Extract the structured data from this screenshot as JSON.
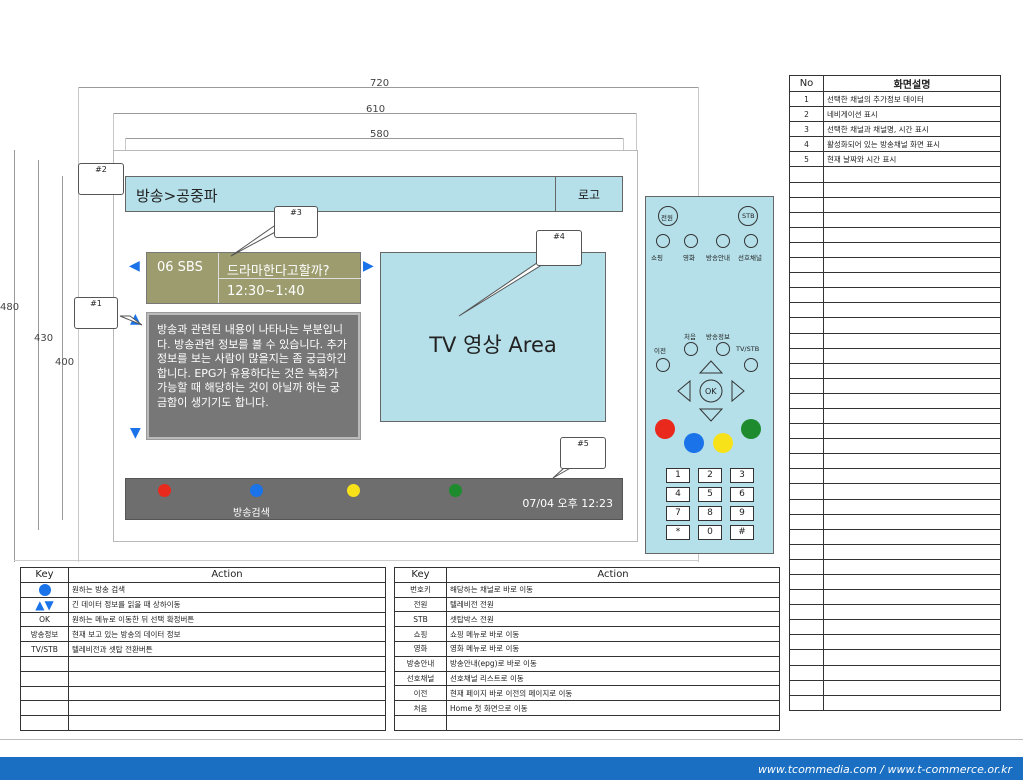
{
  "dimensions": {
    "w720": "720",
    "w610": "610",
    "w580": "580",
    "h480": "480",
    "h430": "430",
    "h400": "400"
  },
  "screen": {
    "breadcrumb": "방송>공중파",
    "logo": "로고",
    "channel": {
      "number": "06 SBS",
      "program": "드라마한다고할까?",
      "time": "12:30~1:40"
    },
    "info_text": "방송과 관련된 내용이 나타나는 부분입니다. 방송관련 정보를 볼 수 있습니다. 추가정보를 보는 사람이 많을지는 좀 궁금하긴 합니다. EPG가 유용하다는 것은 녹화가 가능할 때 해당하는 것이 아닐까 하는 궁금함이 생기기도 합니다.",
    "video_label": "TV 영상 Area",
    "bottom_label": "방송검색",
    "datetime": "07/04 오후 12:23",
    "color_dots": [
      "#e8291c",
      "#1a73e8",
      "#f7e21a",
      "#1e8c2e"
    ]
  },
  "callouts": {
    "c1": "#1",
    "c2": "#2",
    "c3": "#3",
    "c4": "#4",
    "c5": "#5"
  },
  "remote": {
    "power": "전원",
    "stb": "STB",
    "row_labels": [
      "쇼핑",
      "영화",
      "방송안내",
      "선호채널"
    ],
    "home": "처음",
    "info": "방송정보",
    "prev": "이전",
    "tvstb": "TV/STB",
    "ok": "OK",
    "keys": [
      "1",
      "2",
      "3",
      "4",
      "5",
      "6",
      "7",
      "8",
      "9",
      "*",
      "0",
      "#"
    ]
  },
  "desc_table": {
    "headers": [
      "No",
      "화면설명"
    ],
    "rows": [
      [
        "1",
        "선택한 채널의 추가정보 데이터"
      ],
      [
        "2",
        "네비게이션 표시"
      ],
      [
        "3",
        "선택한 채널과 채널명, 시간 표시"
      ],
      [
        "4",
        "활성화되어 있는 방송채널 화면 표시"
      ],
      [
        "5",
        "현재 날짜와 시간 표시"
      ]
    ],
    "empty_rows": 36
  },
  "key_table_left": {
    "headers": [
      "Key",
      "Action"
    ],
    "rows": [
      [
        "",
        "원하는 방송 검색"
      ],
      [
        "",
        "긴 데이터 정보를 읽을 때 상하이동"
      ],
      [
        "OK",
        "원하는 메뉴로 이동한 뒤 선택 확정버튼"
      ],
      [
        "방송정보",
        "현재 보고 있는 방송의 데이터 정보"
      ],
      [
        "TV/STB",
        "텔레비전과 셋탑 전환버튼"
      ]
    ],
    "empty_rows": 5
  },
  "key_table_right": {
    "headers": [
      "Key",
      "Action"
    ],
    "rows": [
      [
        "번호키",
        "해당하는 채널로 바로 이동"
      ],
      [
        "전원",
        "텔레비전 전원"
      ],
      [
        "STB",
        "셋탑박스 전원"
      ],
      [
        "쇼핑",
        "쇼핑 메뉴로 바로 이동"
      ],
      [
        "영화",
        "영화 메뉴로 바로 이동"
      ],
      [
        "방송안내",
        "방송안내(epg)로 바로 이동"
      ],
      [
        "선호채널",
        "선호채널 리스트로 이동"
      ],
      [
        "이전",
        "현재 페이지 바로 이전의 페이지로 이동"
      ],
      [
        "처음",
        "Home 첫 화면으로 이동"
      ]
    ],
    "empty_rows": 1
  },
  "footer": {
    "text": "www.tcommedia.com / www.t-commerce.or.kr"
  },
  "colors": {
    "screen_blue": "#b5e0ea",
    "channel_box": "#9c9c6f",
    "info_box": "#777777",
    "accent_blue": "#1a73e8",
    "footer_blue": "#1a6fc2"
  }
}
